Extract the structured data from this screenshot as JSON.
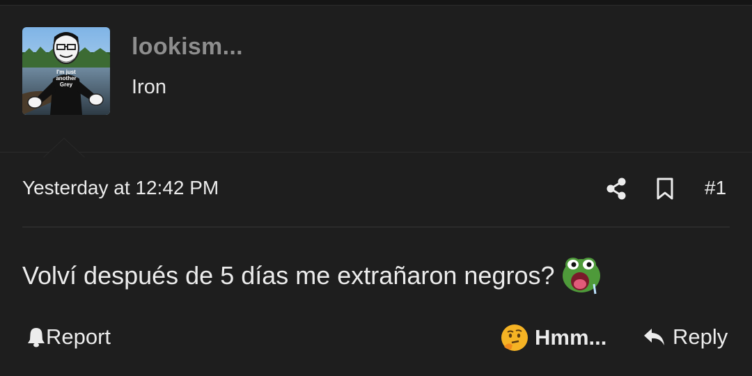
{
  "user": {
    "name": "lookism...",
    "title": "Iron",
    "avatar_shirt_text": "I'm just another Grey"
  },
  "post": {
    "date": "Yesterday at 12:42 PM",
    "number": "#1",
    "message": "Volví después de 5 días me extrañaron negros?"
  },
  "actions": {
    "report_label": "Report",
    "reaction_label": "Hmm...",
    "reply_label": "Reply"
  },
  "icons": {
    "share": "share-icon",
    "bookmark": "bookmark-icon",
    "report": "bell-icon",
    "reaction": "thinking-face-icon",
    "reply": "reply-arrow-icon",
    "emoji": "pepe-pog-emoji"
  },
  "colors": {
    "background": "#1e1e1e",
    "username": "#8e8e8e",
    "text": "#ececec",
    "divider": "#2b2b2b"
  }
}
